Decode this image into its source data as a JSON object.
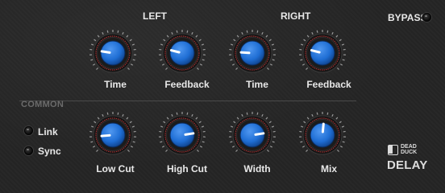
{
  "groups": {
    "left": "LEFT",
    "right": "RIGHT",
    "common": "COMMON"
  },
  "bypass": {
    "label": "BYPASS",
    "on": false
  },
  "knobs": [
    {
      "id": "left-time",
      "label": "Time",
      "value": 0.2
    },
    {
      "id": "left-feedback",
      "label": "Feedback",
      "value": 0.22
    },
    {
      "id": "right-time",
      "label": "Time",
      "value": 0.18
    },
    {
      "id": "right-feedback",
      "label": "Feedback",
      "value": 0.22
    },
    {
      "id": "low-cut",
      "label": "Low Cut",
      "value": 0.15
    },
    {
      "id": "high-cut",
      "label": "High Cut",
      "value": 0.8
    },
    {
      "id": "width",
      "label": "Width",
      "value": 0.8
    },
    {
      "id": "mix",
      "label": "Mix",
      "value": 0.52
    }
  ],
  "toggles": {
    "link": "Link",
    "sync": "Sync"
  },
  "logo": {
    "line1": "DEAD",
    "line2": "DUCK",
    "product": "DELAY"
  },
  "colors": {
    "knob_blue": "#1f6ed4",
    "ring_red": "#a83030",
    "text": "#e8e8e8"
  }
}
